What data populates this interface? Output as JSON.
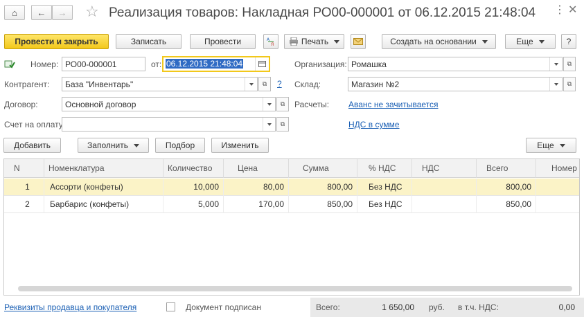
{
  "window": {
    "title": "Реализация товаров: Накладная РО00-000001 от 06.12.2015 21:48:04",
    "home_glyph": "⌂",
    "back_glyph": "←",
    "forward_glyph": "→",
    "star_glyph": "☆",
    "menu_glyph": "⋮",
    "close_glyph": "✕"
  },
  "toolbar": {
    "post_close_label": "Провести и закрыть",
    "save_label": "Записать",
    "post_label": "Провести",
    "print_label": "Печать",
    "create_based_label": "Создать на основании",
    "more_label": "Еще",
    "help_label": "?"
  },
  "form": {
    "number_label": "Номер:",
    "number_value": "РО00-000001",
    "date_label": "от:",
    "date_value": "06.12.2015 21:48:04",
    "org_label": "Организация:",
    "org_value": "Ромашка",
    "counterparty_label": "Контрагент:",
    "counterparty_value": "База \"Инвентарь\"",
    "warehouse_label": "Склад:",
    "warehouse_value": "Магазин №2",
    "contract_label": "Договор:",
    "contract_value": "Основной договор",
    "settlements_label": "Расчеты:",
    "settlements_link": "Аванс не зачитывается",
    "invoice_label": "Счет на оплату:",
    "invoice_value": "",
    "vat_link": "НДС в сумме",
    "question_link": "?"
  },
  "table_toolbar": {
    "add_label": "Добавить",
    "fill_label": "Заполнить",
    "pick_label": "Подбор",
    "change_label": "Изменить",
    "more_label": "Еще"
  },
  "table": {
    "columns": [
      "N",
      "Номенклатура",
      "Количество",
      "Цена",
      "Сумма",
      "% НДС",
      "НДС",
      "Всего",
      "Номер"
    ],
    "rows": [
      {
        "n": "1",
        "item": "Ассорти (конфеты)",
        "qty": "10,000",
        "price": "80,00",
        "sum": "800,00",
        "vat_rate": "Без НДС",
        "vat": "",
        "total": "800,00"
      },
      {
        "n": "2",
        "item": "Барбарис (конфеты)",
        "qty": "5,000",
        "price": "170,00",
        "sum": "850,00",
        "vat_rate": "Без НДС",
        "vat": "",
        "total": "850,00"
      }
    ]
  },
  "footer": {
    "details_link": "Реквизиты продавца и покупателя",
    "signed_label": "Документ подписан",
    "total_label": "Всего:",
    "total_value": "1 650,00",
    "currency": "руб.",
    "vat_incl_label": "в т.ч. НДС:",
    "vat_incl_value": "0,00"
  },
  "colors": {
    "primary_button": "#f2c81b",
    "selected_row": "#fbf3c7",
    "link": "#1a5fb4"
  }
}
